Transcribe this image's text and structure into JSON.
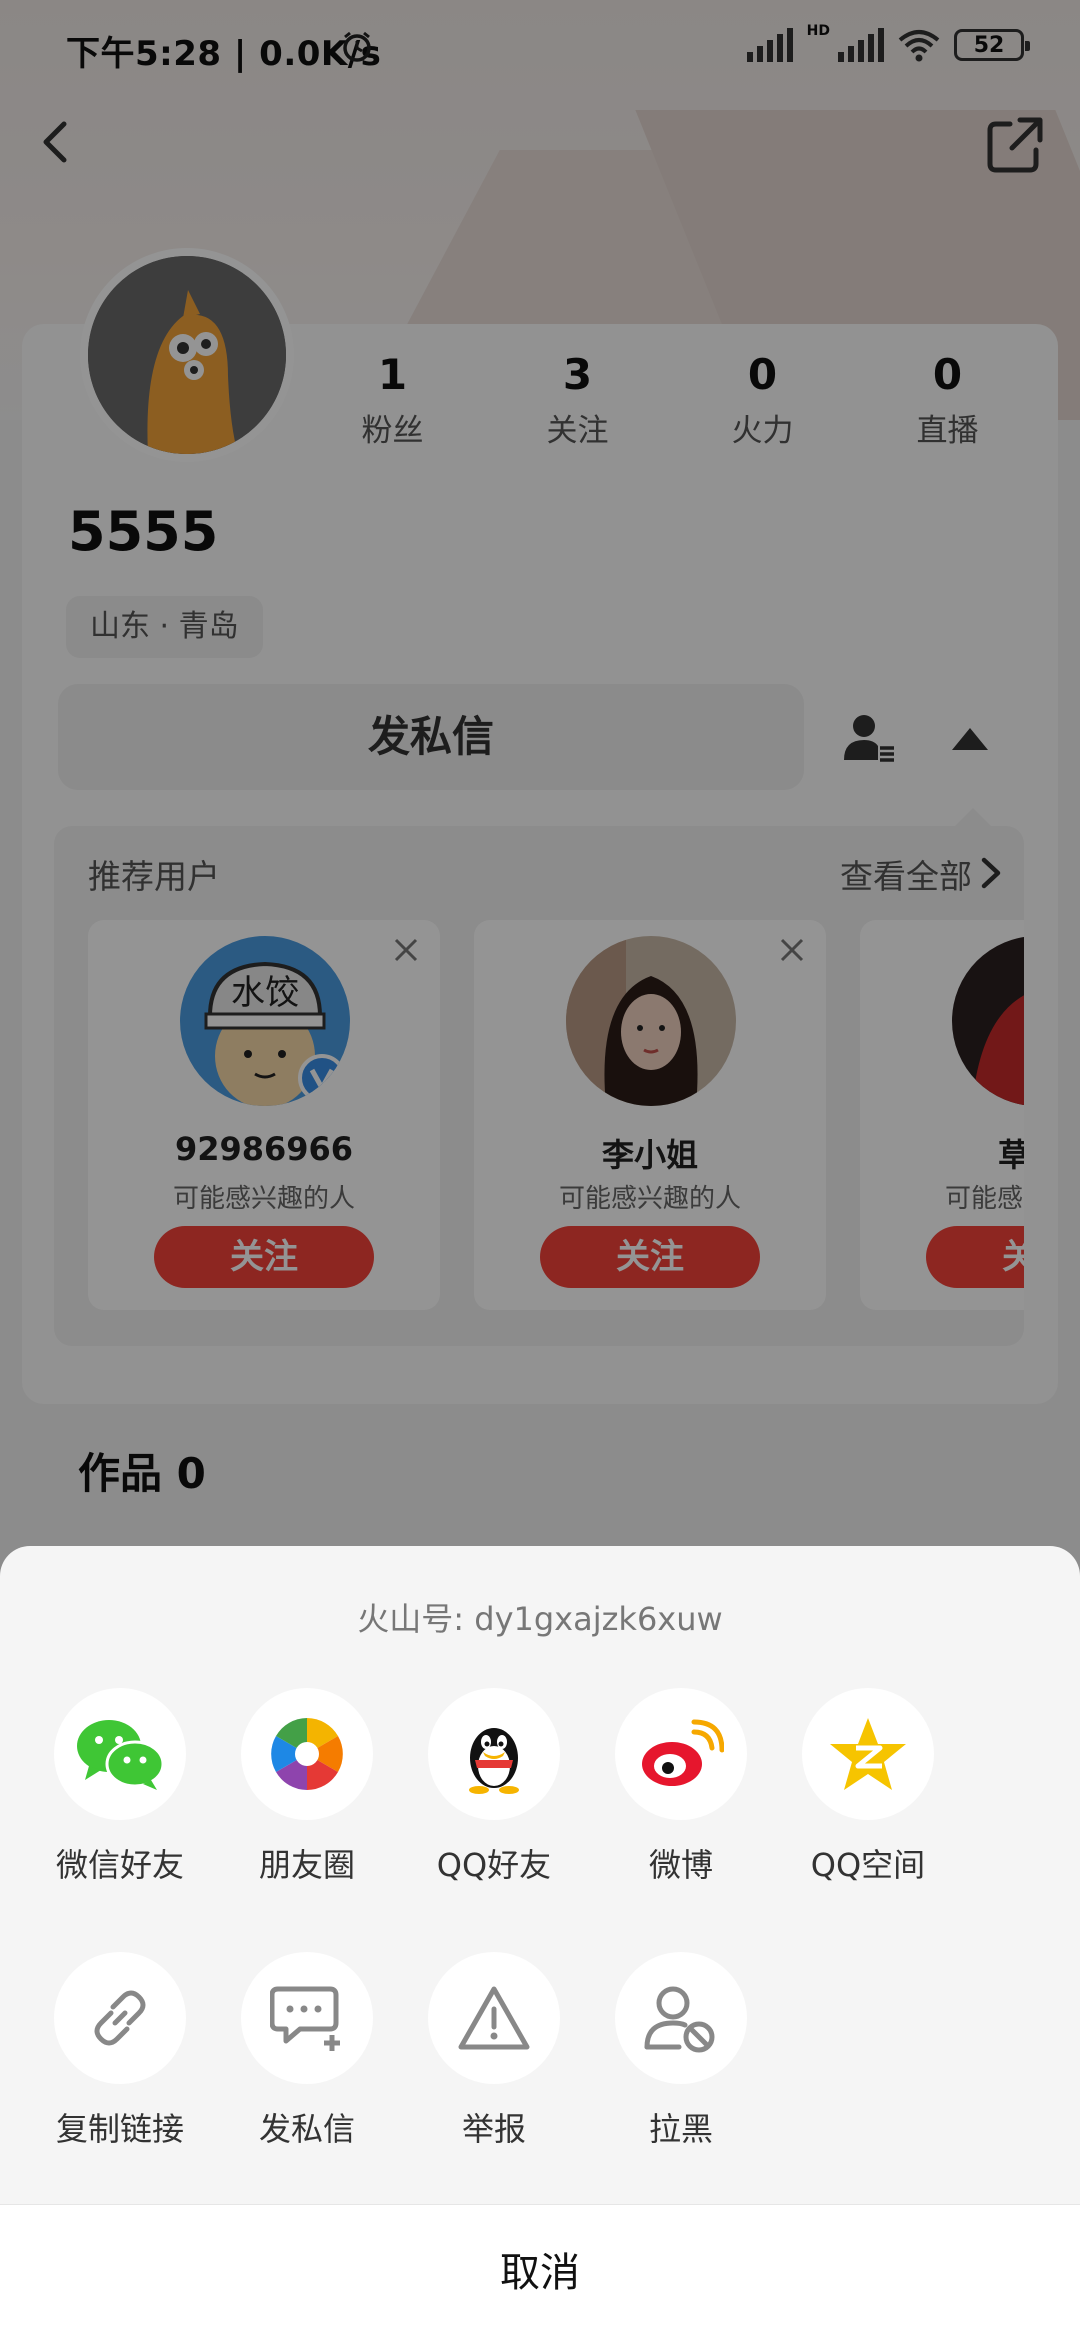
{
  "status_bar": {
    "time": "下午5:28 | 0.0K/s",
    "battery": "52",
    "network_badge": "HD"
  },
  "profile": {
    "nickname": "5555",
    "location": "山东 · 青岛",
    "stats": [
      {
        "num": "1",
        "label": "粉丝"
      },
      {
        "num": "3",
        "label": "关注"
      },
      {
        "num": "0",
        "label": "火力"
      },
      {
        "num": "0",
        "label": "直播"
      }
    ],
    "message_button": "发私信",
    "works": "作品 0"
  },
  "recommended": {
    "title": "推荐用户",
    "view_all": "查看全部",
    "users": [
      {
        "name": "92986966",
        "desc": "可能感兴趣的人",
        "follow": "关注",
        "avatar_text": "水饺"
      },
      {
        "name": "李小姐",
        "desc": "可能感兴趣的人",
        "follow": "关注"
      },
      {
        "name": "草木J",
        "desc": "可能感兴趣的人",
        "follow": "关注"
      }
    ]
  },
  "share_sheet": {
    "id_label": "火山号: dy1gxajzk6xuw",
    "row1": [
      {
        "label": "微信好友",
        "icon": "wechat-icon"
      },
      {
        "label": "朋友圈",
        "icon": "moments-icon"
      },
      {
        "label": "QQ好友",
        "icon": "qq-icon"
      },
      {
        "label": "微博",
        "icon": "weibo-icon"
      },
      {
        "label": "QQ空间",
        "icon": "qzone-icon"
      }
    ],
    "row2": [
      {
        "label": "复制链接",
        "icon": "link-icon"
      },
      {
        "label": "发私信",
        "icon": "message-icon"
      },
      {
        "label": "举报",
        "icon": "warning-icon"
      },
      {
        "label": "拉黑",
        "icon": "block-user-icon"
      }
    ],
    "cancel": "取消"
  },
  "colors": {
    "accent": "#f3433a",
    "wechat": "#3fc635",
    "qzone": "#f6c400",
    "weibo": "#e6162d"
  }
}
